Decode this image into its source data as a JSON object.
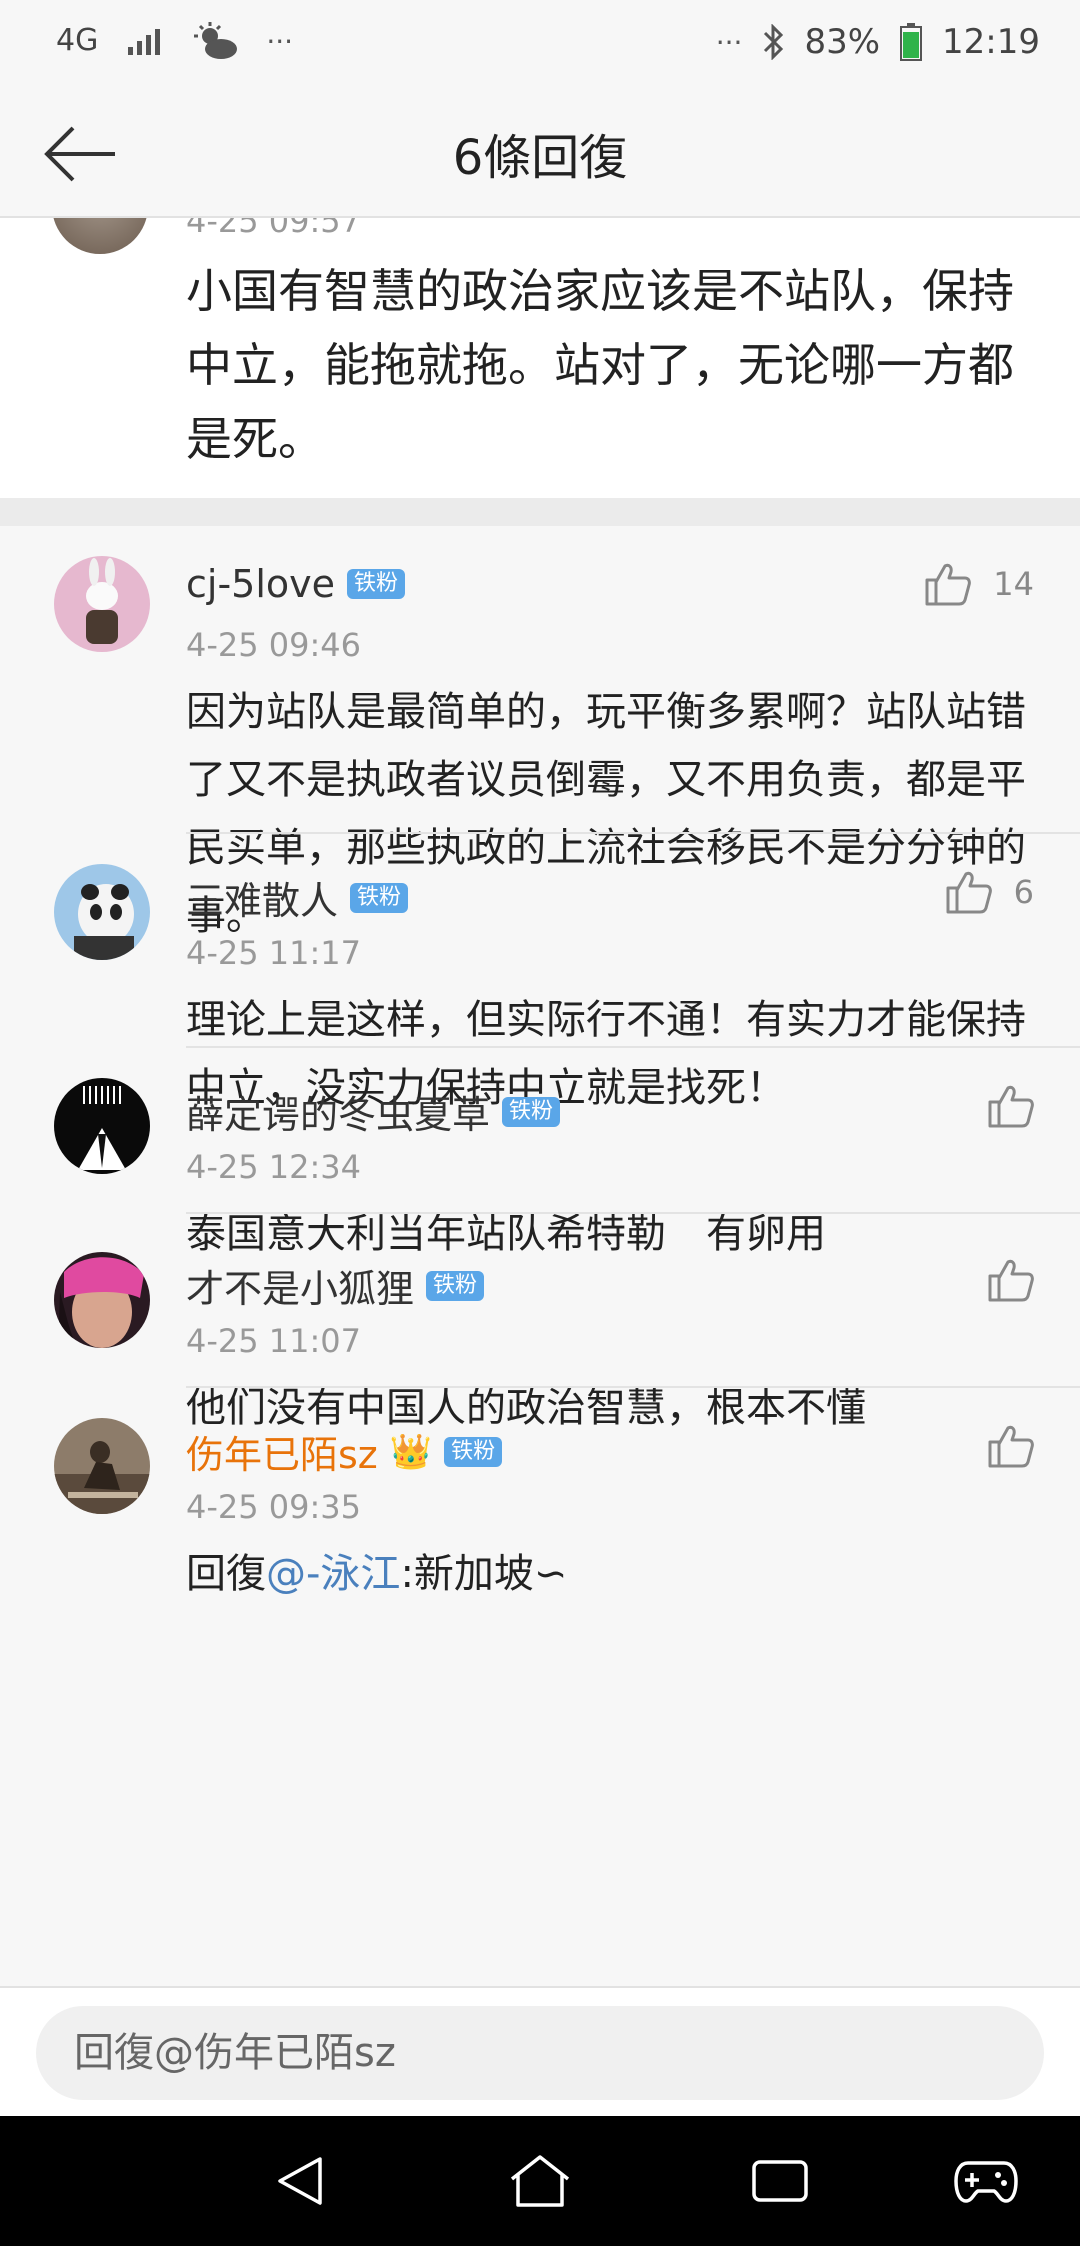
{
  "status_bar": {
    "network": "4G",
    "battery": "83%",
    "time": "12:19",
    "overflow_left": "···",
    "overflow_right": "···"
  },
  "header": {
    "title": "6條回復",
    "back_icon": "arrow-left-icon"
  },
  "top_comment": {
    "time": "4-25 09:57",
    "text": "小国有智慧的政治家应该是不站队，保持中立，能拖就拖。站对了，无论哪一方都是死。"
  },
  "comments": [
    {
      "username": "cj-5love",
      "badge": "铁粉",
      "time": "4-25 09:46",
      "likes": "14",
      "text": "因为站队是最简单的，玩平衡多累啊？站队站错了又不是执政者议员倒霉，又不用负责，都是平民买单，那些执政的上流社会移民不是分分钟的事。"
    },
    {
      "username": "三难散人",
      "badge": "铁粉",
      "time": "4-25 11:17",
      "likes": "6",
      "text": "理论上是这样，但实际行不通！有实力才能保持中立，没实力保持中立就是找死！"
    },
    {
      "username": "薛定谔的冬虫夏草",
      "badge": "铁粉",
      "time": "4-25 12:34",
      "likes": "",
      "text": "泰国意大利当年站队希特勒　有卵用"
    },
    {
      "username": "才不是小狐狸",
      "badge": "铁粉",
      "time": "4-25 11:07",
      "likes": "",
      "text": "他们没有中国人的政治智慧，根本不懂"
    },
    {
      "username": "伤年已陌sz",
      "badge": "铁粉",
      "crown": "👑",
      "time": "4-25 09:35",
      "likes": "",
      "text_prefix": "回復",
      "mention": "@-泳江",
      "text_suffix": ":新加坡∽"
    }
  ],
  "reply_bar": {
    "placeholder": "回復@伤年已陌sz"
  },
  "nav": {
    "back": "nav-back-icon",
    "home": "nav-home-icon",
    "recents": "nav-recents-icon",
    "game": "gamepad-icon"
  }
}
